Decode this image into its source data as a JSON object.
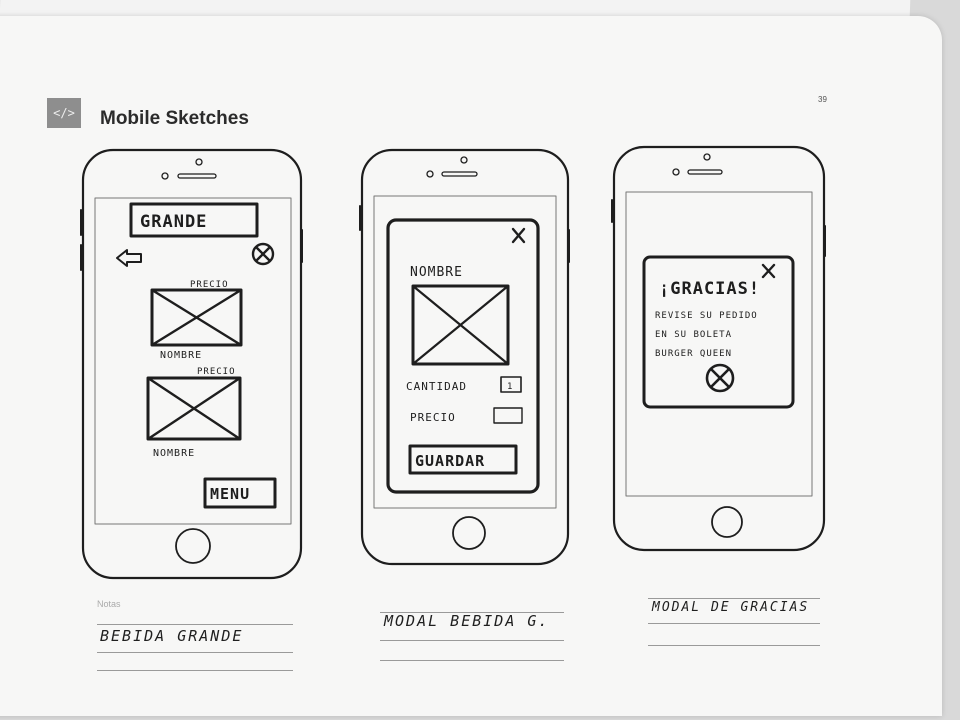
{
  "header": {
    "logo_text": "</>",
    "title": "Mobile Sketches",
    "page_number": "39"
  },
  "phones": [
    {
      "labels": {
        "top_button": "GRANDE",
        "price_1": "PRECIO",
        "name_1": "NOMBRE",
        "price_2": "PRECIO",
        "name_2": "NOMBRE",
        "menu_button": "MENU"
      },
      "icons": [
        "back-arrow-icon",
        "close-circle-icon",
        "image-placeholder-icon",
        "image-placeholder-icon"
      ]
    },
    {
      "labels": {
        "name": "NOMBRE",
        "quantity": "CANTIDAD",
        "quantity_value": "1",
        "price": "PRECIO",
        "save_button": "GUARDAR",
        "close": "×"
      },
      "icons": [
        "close-icon",
        "image-placeholder-icon"
      ]
    },
    {
      "labels": {
        "title": "¡GRACIAS!",
        "line_1": "REVISE SU PEDIDO",
        "line_2": "EN SU BOLETA",
        "line_3": "BURGER QUEEN",
        "close": "×"
      },
      "icons": [
        "close-icon",
        "close-circle-icon"
      ]
    }
  ],
  "notes": {
    "label": "Notas",
    "captions": [
      "BEBIDA GRANDE",
      "MODAL BEBIDA G.",
      "MODAL DE GRACIAS"
    ]
  }
}
